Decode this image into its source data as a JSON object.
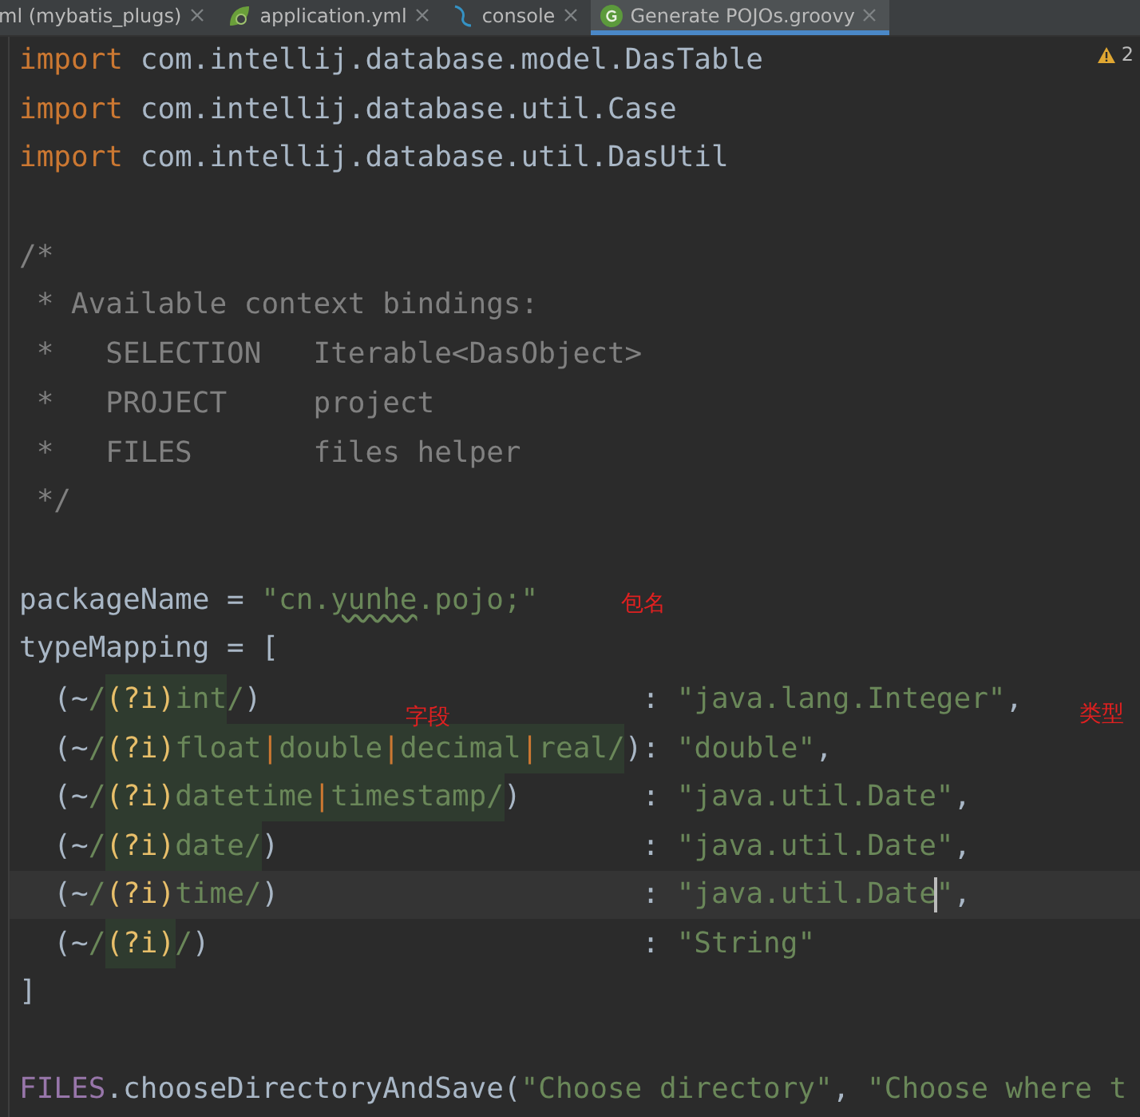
{
  "tabs": [
    {
      "label": "ml (mybatis_plugs)",
      "selected": false
    },
    {
      "label": "application.yml",
      "selected": false
    },
    {
      "label": "console",
      "selected": false
    },
    {
      "label": "Generate POJOs.groovy",
      "selected": true
    }
  ],
  "warnings": {
    "count": "2"
  },
  "lines": [
    {
      "kind": "code",
      "segments": [
        {
          "text": "import",
          "kind": "keyword"
        },
        {
          "text": " com.intellij.database.model.DasTable",
          "kind": "plain"
        }
      ]
    },
    {
      "kind": "code",
      "segments": [
        {
          "text": "import",
          "kind": "keyword"
        },
        {
          "text": " com.intellij.database.util.Case",
          "kind": "plain"
        }
      ]
    },
    {
      "kind": "code",
      "segments": [
        {
          "text": "import",
          "kind": "keyword"
        },
        {
          "text": " com.intellij.database.util.DasUtil",
          "kind": "plain"
        }
      ]
    },
    {
      "kind": "blank"
    },
    {
      "kind": "code",
      "segments": [
        {
          "text": "/*",
          "kind": "comment"
        }
      ]
    },
    {
      "kind": "code",
      "segments": [
        {
          "text": " * Available context bindings:",
          "kind": "comment"
        }
      ]
    },
    {
      "kind": "code",
      "segments": [
        {
          "text": " *   SELECTION   Iterable<DasObject>",
          "kind": "comment"
        }
      ]
    },
    {
      "kind": "code",
      "segments": [
        {
          "text": " *   PROJECT     project",
          "kind": "comment"
        }
      ]
    },
    {
      "kind": "code",
      "segments": [
        {
          "text": " *   FILES       files helper",
          "kind": "comment"
        }
      ]
    },
    {
      "kind": "code",
      "segments": [
        {
          "text": " */",
          "kind": "comment"
        }
      ]
    },
    {
      "kind": "blank"
    },
    {
      "kind": "code",
      "segments": [
        {
          "text": "packageName = ",
          "kind": "plain"
        },
        {
          "text": "\"cn.",
          "kind": "string"
        },
        {
          "text": "yunhe",
          "kind": "string",
          "typo": true
        },
        {
          "text": ".pojo;\"",
          "kind": "string"
        }
      ],
      "note": "包名"
    },
    {
      "kind": "code",
      "segments": [
        {
          "text": "typeMapping = [",
          "kind": "plain"
        }
      ]
    },
    {
      "kind": "code",
      "segments": [
        {
          "text": "  (~",
          "kind": "plain"
        },
        {
          "text": "/",
          "kind": "regex"
        },
        {
          "text": "(?i)",
          "kind": "regex-flag",
          "highlighted": true
        },
        {
          "text": "int",
          "kind": "regex",
          "highlighted": true
        },
        {
          "text": "/",
          "kind": "regex"
        },
        {
          "text": ")                      : ",
          "kind": "plain"
        },
        {
          "text": "\"java.lang.Integer\"",
          "kind": "string"
        },
        {
          "text": ",",
          "kind": "plain"
        }
      ],
      "note": "字段"
    },
    {
      "kind": "code",
      "segments": [
        {
          "text": "  (~",
          "kind": "plain"
        },
        {
          "text": "/",
          "kind": "regex"
        },
        {
          "text": "(?i)",
          "kind": "regex-flag",
          "highlighted": true
        },
        {
          "text": "float",
          "kind": "regex",
          "highlighted": true
        },
        {
          "text": "|",
          "kind": "regex-pipe",
          "highlighted": true
        },
        {
          "text": "double",
          "kind": "regex",
          "highlighted": true
        },
        {
          "text": "|",
          "kind": "regex-pipe",
          "highlighted": true
        },
        {
          "text": "decimal",
          "kind": "regex",
          "highlighted": true
        },
        {
          "text": "|",
          "kind": "regex-pipe",
          "highlighted": true
        },
        {
          "text": "real",
          "kind": "regex",
          "highlighted": true
        },
        {
          "text": "/",
          "kind": "regex",
          "highlighted": true
        },
        {
          "text": "): ",
          "kind": "plain"
        },
        {
          "text": "\"double\"",
          "kind": "string"
        },
        {
          "text": ",",
          "kind": "plain"
        }
      ],
      "note": "类型"
    },
    {
      "kind": "code",
      "segments": [
        {
          "text": "  (~",
          "kind": "plain"
        },
        {
          "text": "/",
          "kind": "regex"
        },
        {
          "text": "(?i)",
          "kind": "regex-flag",
          "highlighted": true
        },
        {
          "text": "datetime",
          "kind": "regex",
          "highlighted": true
        },
        {
          "text": "|",
          "kind": "regex-pipe",
          "highlighted": true
        },
        {
          "text": "timestamp",
          "kind": "regex",
          "highlighted": true
        },
        {
          "text": "/",
          "kind": "regex",
          "highlighted": true
        },
        {
          "text": ")       : ",
          "kind": "plain"
        },
        {
          "text": "\"java.util.Date\"",
          "kind": "string"
        },
        {
          "text": ",",
          "kind": "plain"
        }
      ]
    },
    {
      "kind": "code",
      "segments": [
        {
          "text": "  (~",
          "kind": "plain"
        },
        {
          "text": "/",
          "kind": "regex"
        },
        {
          "text": "(?i)",
          "kind": "regex-flag",
          "highlighted": true
        },
        {
          "text": "date",
          "kind": "regex",
          "highlighted": true
        },
        {
          "text": "/",
          "kind": "regex",
          "highlighted": true
        },
        {
          "text": ")                     : ",
          "kind": "plain"
        },
        {
          "text": "\"java.util.Date\"",
          "kind": "string"
        },
        {
          "text": ",",
          "kind": "plain"
        }
      ]
    },
    {
      "kind": "code",
      "current": true,
      "segments": [
        {
          "text": "  (~",
          "kind": "plain"
        },
        {
          "text": "/",
          "kind": "regex"
        },
        {
          "text": "(?i)",
          "kind": "regex-flag"
        },
        {
          "text": "time",
          "kind": "regex"
        },
        {
          "text": "/",
          "kind": "regex"
        },
        {
          "text": ")                     : ",
          "kind": "plain"
        },
        {
          "text": "\"java.util.Date",
          "kind": "string",
          "caret_after": true
        },
        {
          "text": "\"",
          "kind": "string"
        },
        {
          "text": ",",
          "kind": "plain"
        }
      ]
    },
    {
      "kind": "code",
      "segments": [
        {
          "text": "  (~",
          "kind": "plain"
        },
        {
          "text": "/",
          "kind": "regex"
        },
        {
          "text": "(?i)",
          "kind": "regex-flag",
          "highlighted": true
        },
        {
          "text": "/",
          "kind": "regex"
        },
        {
          "text": ")                         : ",
          "kind": "plain"
        },
        {
          "text": "\"String\"",
          "kind": "string"
        }
      ]
    },
    {
      "kind": "code",
      "segments": [
        {
          "text": "]",
          "kind": "plain"
        }
      ]
    },
    {
      "kind": "blank"
    },
    {
      "kind": "code",
      "segments": [
        {
          "text": "FILES",
          "kind": "constant"
        },
        {
          "text": ".chooseDirectoryAndSave(",
          "kind": "plain"
        },
        {
          "text": "\"Choose directory\"",
          "kind": "string"
        },
        {
          "text": ", ",
          "kind": "plain"
        },
        {
          "text": "\"Choose where t",
          "kind": "string"
        }
      ]
    }
  ]
}
